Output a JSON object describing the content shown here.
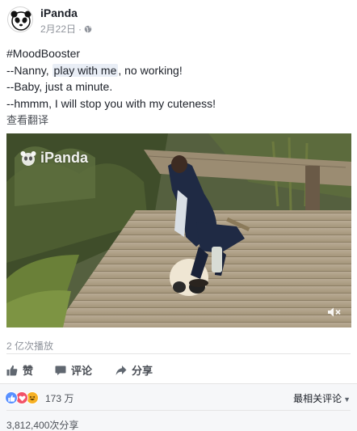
{
  "post": {
    "page_name": "iPanda",
    "date": "2月22日",
    "dot": "·",
    "hashtag": "#MoodBooster",
    "lines": [
      {
        "pre": "--Nanny, ",
        "highlight": "play with me",
        "post": ", no working!"
      },
      {
        "pre": "--Baby, just a minute.",
        "highlight": "",
        "post": ""
      },
      {
        "pre": "--hmmm, I will stop you with my cuteness!",
        "highlight": "",
        "post": ""
      }
    ],
    "translate_label": "查看翻译"
  },
  "video": {
    "watermark": "iPanda",
    "mute_icon": "speaker-muted-icon"
  },
  "stats": {
    "views": "2 亿次播放",
    "reaction_count": "173 万",
    "sort_label": "最相关评论",
    "shares": "3,812,400次分享"
  },
  "actions": {
    "like": "赞",
    "comment": "评论",
    "share": "分享"
  },
  "colors": {
    "text": "#1d2129",
    "muted": "#90949c",
    "like_blue": "#5890ff",
    "love_red": "#f25268",
    "haha_yellow": "#f7b125"
  }
}
